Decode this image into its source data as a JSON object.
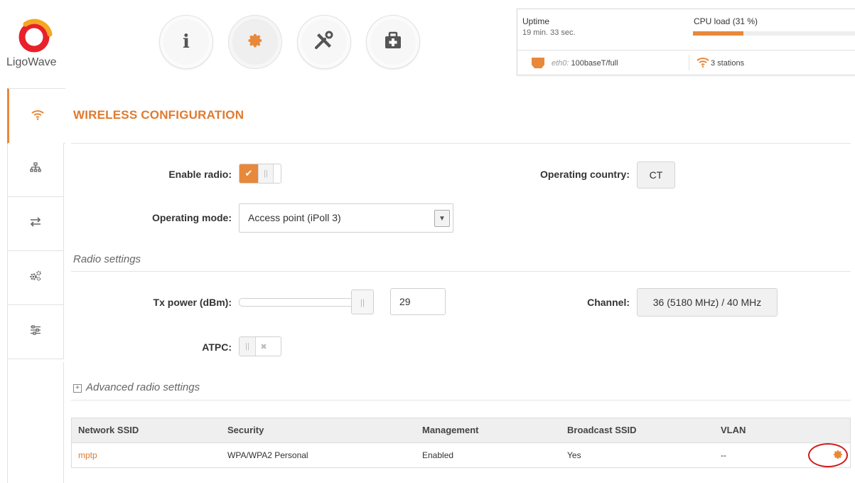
{
  "brand": {
    "name": "LigoWave",
    "accent": "#e8883a",
    "logo_colors": [
      "#e8212a",
      "#f5a623"
    ]
  },
  "nav": [
    {
      "name": "info-icon"
    },
    {
      "name": "gear-icon",
      "active": true
    },
    {
      "name": "tools-icon"
    },
    {
      "name": "first-aid-icon"
    }
  ],
  "status": {
    "uptime_label": "Uptime",
    "uptime_value": "19 min. 33 sec.",
    "cpu_label": "CPU load (31 %)",
    "cpu_percent": 31,
    "eth_name": "eth0:",
    "eth_value": "100baseT/full",
    "stations": "3 stations"
  },
  "sidebar": [
    {
      "icon": "wifi-icon",
      "active": true
    },
    {
      "icon": "network-tree-icon"
    },
    {
      "icon": "arrows-exchange-icon"
    },
    {
      "icon": "gears-icon"
    },
    {
      "icon": "sliders-icon"
    }
  ],
  "page": {
    "title": "WIRELESS CONFIGURATION",
    "enable_radio_label": "Enable radio:",
    "enable_radio": true,
    "operating_country_label": "Operating country:",
    "operating_country": "CT",
    "operating_mode_label": "Operating mode:",
    "operating_mode": "Access point (iPoll 3)",
    "radio_settings_title": "Radio settings",
    "tx_power_label": "Tx power (dBm):",
    "tx_power": "29",
    "channel_label": "Channel:",
    "channel": "36 (5180 MHz) / 40 MHz",
    "atpc_label": "ATPC:",
    "atpc": false,
    "advanced_title": "Advanced radio settings"
  },
  "table": {
    "headers": [
      "Network SSID",
      "Security",
      "Management",
      "Broadcast SSID",
      "VLAN"
    ],
    "rows": [
      [
        "mptp",
        "WPA/WPA2 Personal",
        "Enabled",
        "Yes",
        "--"
      ]
    ]
  }
}
